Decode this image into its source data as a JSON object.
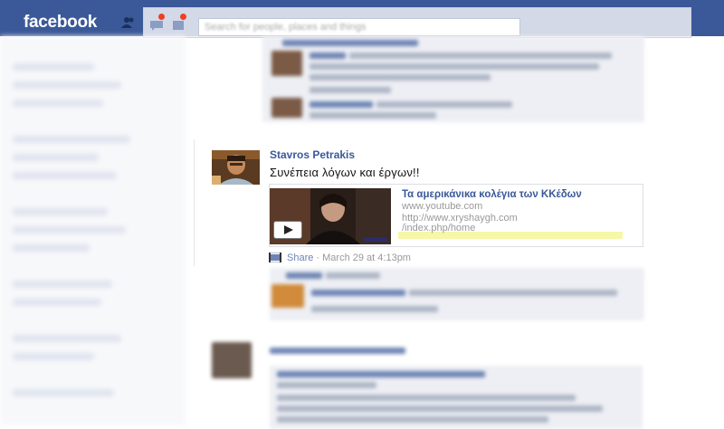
{
  "topbar": {
    "logo": "facebook",
    "search_placeholder": "Search for people, places and things",
    "friend_icon": "friend-requests-icon",
    "messages_icon": "messages-icon",
    "notifications_icon": "notifications-icon"
  },
  "post": {
    "author": "Stavros Petrakis",
    "text": "Συνέπεια λόγων και έργων!!",
    "attachment": {
      "title": "Τα αμερικάνικα κολέγια των ΚΚέδων",
      "source": "www.youtube.com",
      "url_line1": "http://www.xryshaygh.com",
      "url_line2": "/index.php/home"
    },
    "actions": {
      "share": "Share",
      "separator": " · ",
      "timestamp": "March 29 at 4:13pm"
    }
  },
  "colors": {
    "brand": "#3b5998",
    "link": "#3b5998",
    "meta": "#999999",
    "comment_bg": "#edeff4"
  }
}
